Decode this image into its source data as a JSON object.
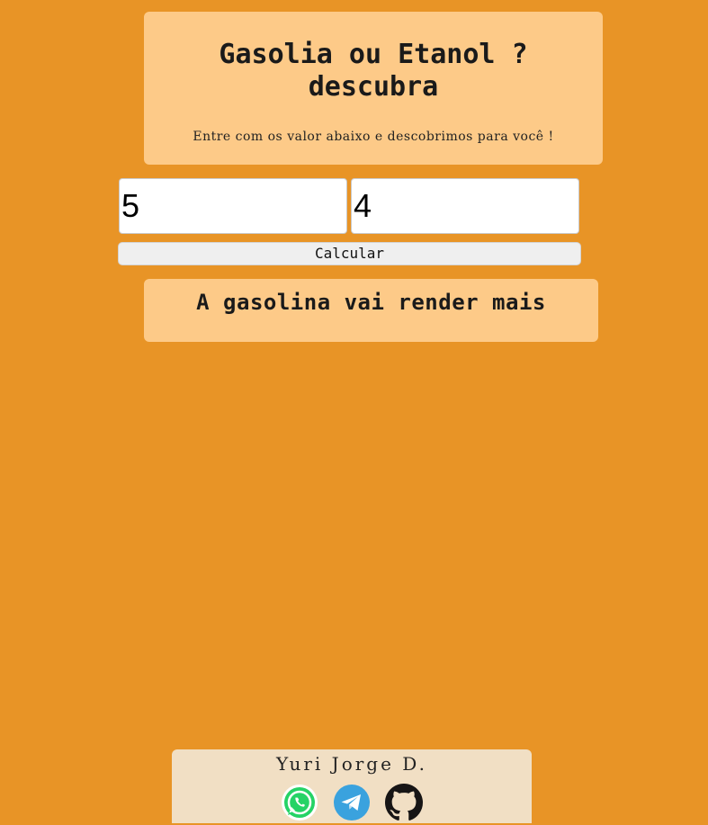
{
  "header": {
    "title": "Gasolia ou Etanol ? descubra",
    "subtitle": "Entre com os valor abaixo e descobrimos para você !"
  },
  "form": {
    "gasoline_value": "5",
    "ethanol_value": "4",
    "calculate_label": "Calcular"
  },
  "result": {
    "text": "A gasolina vai render mais"
  },
  "footer": {
    "author": "Yuri Jorge D.",
    "links": [
      {
        "icon": "whatsapp-icon",
        "color": "#25D366"
      },
      {
        "icon": "telegram-icon",
        "color": "#3AA2DE"
      },
      {
        "icon": "github-icon",
        "color": "#171515"
      }
    ]
  },
  "colors": {
    "background": "#E89426",
    "card": "#FDCA88",
    "footer": "#F1DFC4"
  }
}
